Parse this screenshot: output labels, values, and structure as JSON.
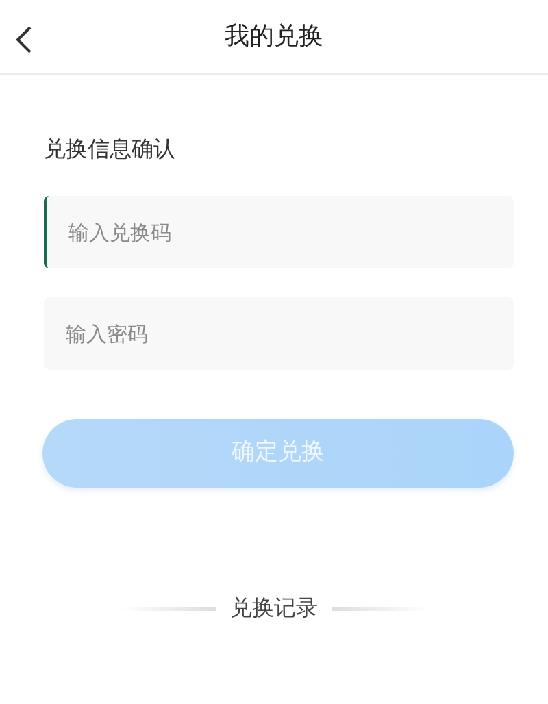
{
  "header": {
    "title": "我的兑换"
  },
  "section_title": "兑换信息确认",
  "fields": [
    {
      "placeholder": "输入兑换码",
      "focused": true
    },
    {
      "placeholder": "输入密码",
      "focused": false
    }
  ],
  "submit_button": {
    "label": "确定兑换",
    "disabled": true
  },
  "history_link": "兑换记录"
}
